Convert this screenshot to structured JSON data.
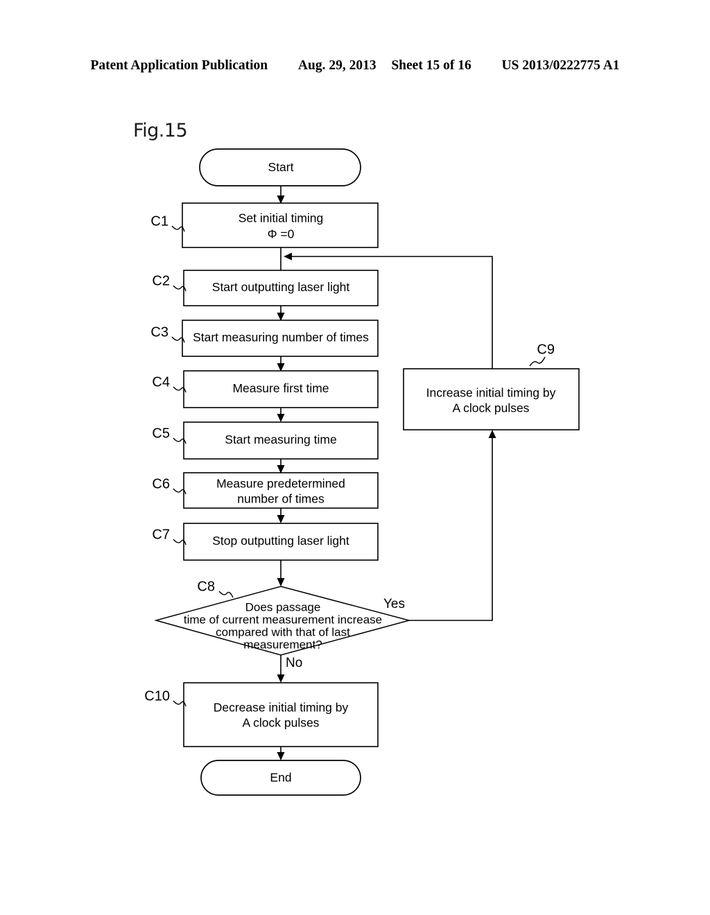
{
  "header": {
    "publication": "Patent Application Publication",
    "date": "Aug. 29, 2013",
    "sheet": "Sheet 15 of 16",
    "patent_number": "US 2013/0222775 A1"
  },
  "figure": {
    "label": "Fig.15"
  },
  "flowchart": {
    "nodes": [
      {
        "id": "start",
        "step": "",
        "type": "terminator",
        "lines": [
          "Start"
        ]
      },
      {
        "id": "c1",
        "step": "C1",
        "type": "process",
        "lines": [
          "Set initial timing",
          "Φ =0"
        ]
      },
      {
        "id": "c2",
        "step": "C2",
        "type": "process",
        "lines": [
          "Start outputting laser light"
        ]
      },
      {
        "id": "c3",
        "step": "C3",
        "type": "process",
        "lines": [
          "Start measuring number of times"
        ]
      },
      {
        "id": "c4",
        "step": "C4",
        "type": "process",
        "lines": [
          "Measure first time"
        ]
      },
      {
        "id": "c5",
        "step": "C5",
        "type": "process",
        "lines": [
          "Start measuring time"
        ]
      },
      {
        "id": "c6",
        "step": "C6",
        "type": "process",
        "lines": [
          "Measure predetermined",
          "number of times"
        ]
      },
      {
        "id": "c7",
        "step": "C7",
        "type": "process",
        "lines": [
          "Stop outputting laser light"
        ]
      },
      {
        "id": "c8",
        "step": "C8",
        "type": "decision",
        "lines": [
          "Does passage",
          "time of current measurement increase",
          "compared with that of last",
          "measurement?"
        ]
      },
      {
        "id": "c9",
        "step": "C9",
        "type": "process",
        "lines": [
          "Increase initial timing by",
          "A clock pulses"
        ]
      },
      {
        "id": "c10",
        "step": "C10",
        "type": "process",
        "lines": [
          "Decrease initial timing by",
          "A clock pulses"
        ]
      },
      {
        "id": "end",
        "step": "",
        "type": "terminator",
        "lines": [
          "End"
        ]
      }
    ],
    "branches": {
      "yes": "Yes",
      "no": "No"
    }
  }
}
